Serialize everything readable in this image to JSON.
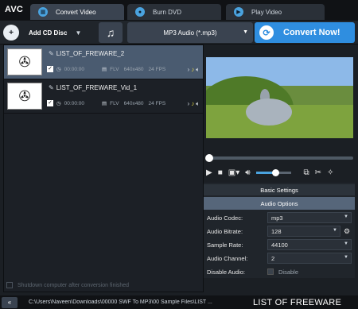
{
  "app": {
    "logo": "AVC"
  },
  "tabs": [
    {
      "label": "Convert Video",
      "icon": "film-icon",
      "active": true
    },
    {
      "label": "Burn DVD",
      "icon": "disc-icon",
      "active": false
    },
    {
      "label": "Play Video",
      "icon": "play-icon",
      "active": false
    }
  ],
  "toolbar": {
    "add_cd_label": "Add CD Disc",
    "format_label": "MP3 Audio (*.mp3)",
    "convert_label": "Convert Now!"
  },
  "files": [
    {
      "name": "LIST_OF_FREWARE_2",
      "time": "00:00:00",
      "format": "FLV",
      "resolution": "640x480",
      "fps": "24 FPS",
      "checked": true,
      "selected": true
    },
    {
      "name": "LIST_OF_FREWARE_Vid_1",
      "time": "00:00:00",
      "format": "FLV",
      "resolution": "640x480",
      "fps": "24 FPS",
      "checked": true,
      "selected": false
    }
  ],
  "shutdown_label": "Shutdown computer after conversion finished",
  "player": {
    "seek_fraction": 0.0,
    "volume_fraction": 0.55
  },
  "settings": {
    "basic_label": "Basic Settings",
    "audio_options_label": "Audio Options",
    "rows": [
      {
        "label": "Audio Codec:",
        "value": "mp3"
      },
      {
        "label": "Audio Bitrate:",
        "value": "128"
      },
      {
        "label": "Sample Rate:",
        "value": "44100"
      },
      {
        "label": "Audio Channel:",
        "value": "2"
      },
      {
        "label": "Disable Audio:",
        "value": "Disable"
      }
    ]
  },
  "status": {
    "path": "C:\\Users\\Naveen\\Downloads\\00000 SWF To MP3\\00 Sample Files\\LIST ...",
    "brand": "LIST OF FREEWARE"
  },
  "colors": {
    "accent": "#2f8ee0",
    "selected_row": "#4a5b70",
    "audio_header": "#56667a"
  }
}
